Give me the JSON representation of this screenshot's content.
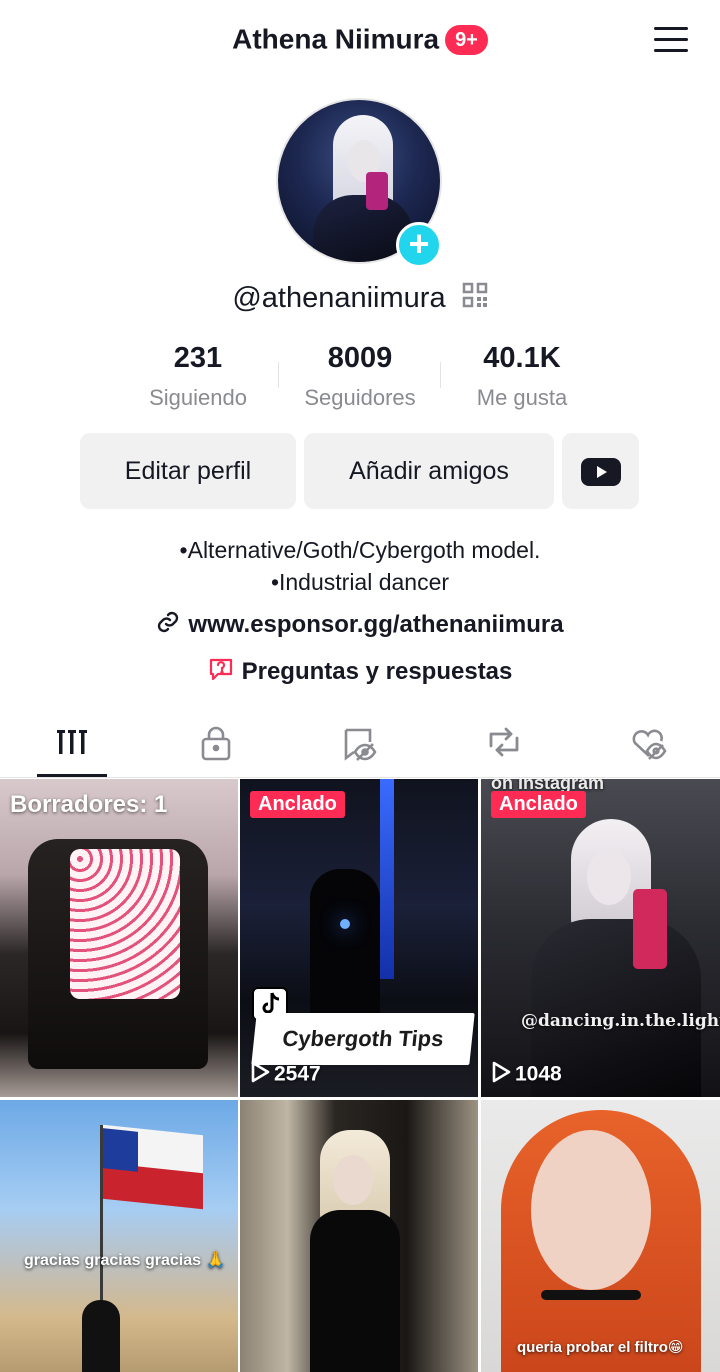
{
  "header": {
    "name": "Athena Niimura",
    "badge": "9+"
  },
  "profile": {
    "username": "@athenaniimura",
    "stats": [
      {
        "value": "231",
        "label": "Siguiendo"
      },
      {
        "value": "8009",
        "label": "Seguidores"
      },
      {
        "value": "40.1K",
        "label": "Me gusta"
      }
    ],
    "buttons": {
      "edit": "Editar perfil",
      "add_friends": "Añadir amigos"
    },
    "bio": [
      "•Alternative/Goth/Cybergoth model.",
      "•Industrial dancer"
    ],
    "link": "www.esponsor.gg/athenaniimura",
    "qa": "Preguntas y respuestas"
  },
  "tabs": [
    {
      "icon": "grid-icon",
      "active": true
    },
    {
      "icon": "lock-icon"
    },
    {
      "icon": "bookmark-hidden-icon"
    },
    {
      "icon": "repost-icon"
    },
    {
      "icon": "liked-hidden-icon"
    }
  ],
  "videos": [
    {
      "overlay": "Borradores: 1"
    },
    {
      "pin": "Anclado",
      "caption": "Cybergoth Tips",
      "views": "2547"
    },
    {
      "pin": "Anclado",
      "top_text": "on Instagram",
      "caption": "@dancing.in.the.light",
      "views": "1048"
    },
    {
      "caption": "gracias gracias gracias 🙏"
    },
    {},
    {
      "caption": "queria probar el filtro😁"
    }
  ],
  "colors": {
    "accent": "#fe2c55",
    "teal": "#20d5ec",
    "text": "#161823",
    "muted": "#8a8b91",
    "button_bg": "#f1f1f2"
  }
}
